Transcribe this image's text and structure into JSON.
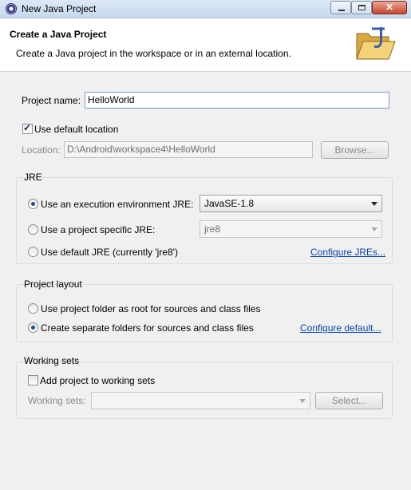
{
  "window": {
    "title": "New Java Project",
    "minimize_icon": "minimize-icon",
    "maximize_icon": "maximize-icon",
    "close_icon": "close-icon"
  },
  "banner": {
    "heading": "Create a Java Project",
    "description": "Create a Java project in the workspace or in an external location."
  },
  "project_name": {
    "label": "Project name:",
    "value": "HelloWorld"
  },
  "location": {
    "use_default_label": "Use default location",
    "use_default_checked": true,
    "label": "Location:",
    "value": "D:\\Android\\workspace4\\HelloWorld",
    "browse_label": "Browse..."
  },
  "jre": {
    "title": "JRE",
    "options": [
      {
        "label": "Use an execution environment JRE:",
        "selected": true,
        "combo": "JavaSE-1.8"
      },
      {
        "label": "Use a project specific JRE:",
        "selected": false,
        "combo": "jre8"
      },
      {
        "label": "Use default JRE (currently 'jre8')",
        "selected": false
      }
    ],
    "configure_link": "Configure JREs..."
  },
  "project_layout": {
    "title": "Project layout",
    "options": [
      {
        "label": "Use project folder as root for sources and class files",
        "selected": false
      },
      {
        "label": "Create separate folders for sources and class files",
        "selected": true
      }
    ],
    "configure_link": "Configure default..."
  },
  "working_sets": {
    "title": "Working sets",
    "add_label": "Add project to working sets",
    "add_checked": false,
    "field_label": "Working sets:",
    "field_value": "",
    "select_label": "Select..."
  },
  "colors": {
    "link": "#0645ad",
    "selected_radio": "#1c4f8a"
  }
}
